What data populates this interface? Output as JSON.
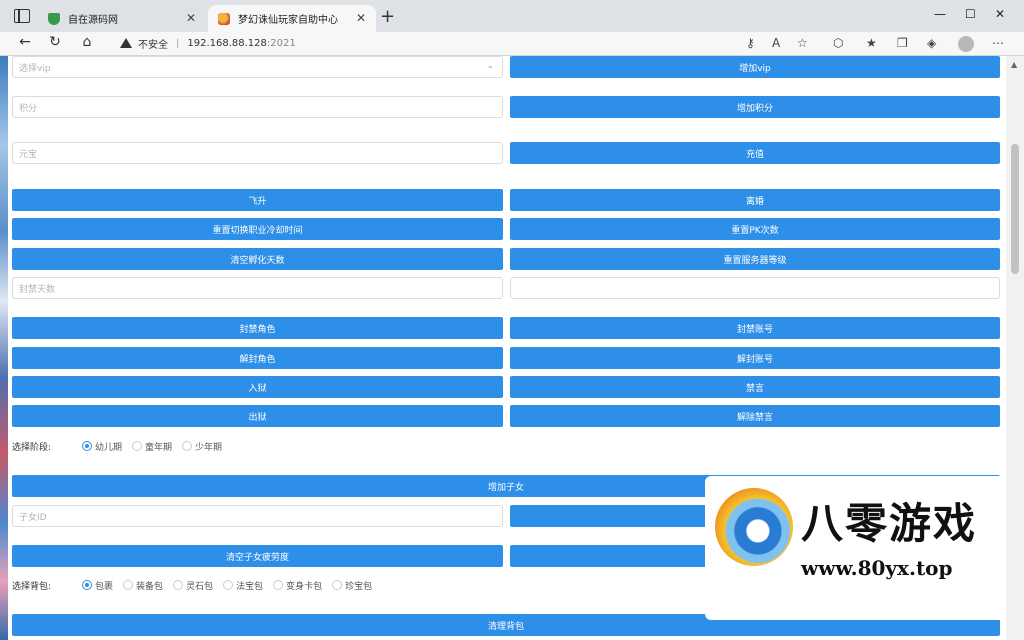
{
  "browser": {
    "tabs": [
      {
        "label": "自在源码网",
        "active": false
      },
      {
        "label": "梦幻诛仙玩家自助中心",
        "active": true
      }
    ],
    "address": {
      "security_label": "不安全",
      "host": "192.168.88.128",
      "port": ":2021"
    }
  },
  "form": {
    "vip_select_placeholder": "选择vip",
    "add_vip": "增加vip",
    "points_placeholder": "积分",
    "add_points": "增加积分",
    "yuanbao_placeholder": "元宝",
    "recharge": "充值",
    "ascend": "飞升",
    "leave_sect": "离婚",
    "reset_job_cd": "重置切换职业冷却时间",
    "reset_pk": "重置PK次数",
    "clear_incubate": "清空孵化天数",
    "reset_server_level": "重置服务器等级",
    "ban_days_placeholder": "封禁天数",
    "ban_role": "封禁角色",
    "ban_account": "封禁账号",
    "unban_role": "解封角色",
    "unban_account": "解封账号",
    "jail": "入狱",
    "mute": "禁言",
    "release": "出狱",
    "unmute": "解除禁言",
    "stage_label": "选择阶段:",
    "stages": [
      "幼儿期",
      "童年期",
      "少年期"
    ],
    "stage_selected": 0,
    "add_child": "增加子女",
    "child_id_placeholder": "子女ID",
    "clear_child_fatigue": "清空子女疲劳度",
    "bag_label": "选择背包:",
    "bags": [
      "包裹",
      "装备包",
      "灵石包",
      "法宝包",
      "变身卡包",
      "珍宝包"
    ],
    "bag_selected": 0,
    "clean_bag": "清理背包"
  },
  "watermark": {
    "cn": "八零游戏",
    "url": "www.80yx.top"
  }
}
